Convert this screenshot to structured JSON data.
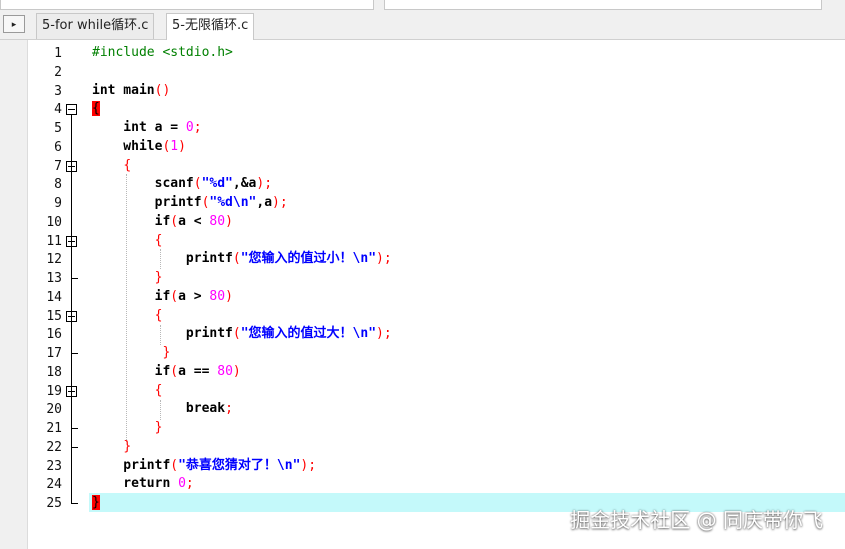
{
  "tabs": [
    {
      "label": "5-for while循环.c",
      "active": false
    },
    {
      "label": "5-无限循环.c",
      "active": true
    }
  ],
  "nav_button_glyph": "▸",
  "line_numbers": [
    "1",
    "2",
    "3",
    "4",
    "5",
    "6",
    "7",
    "8",
    "9",
    "10",
    "11",
    "12",
    "13",
    "14",
    "15",
    "16",
    "17",
    "18",
    "19",
    "20",
    "21",
    "22",
    "23",
    "24",
    "25"
  ],
  "current_line": 25,
  "colors": {
    "keyword": "#000000",
    "preprocessor": "#008000",
    "brace": "#ff0000",
    "string": "#0000ff",
    "number": "#ff00ff",
    "current_line_bg": "#c4f9fa"
  },
  "code": [
    [
      {
        "t": "#include <stdio.h>",
        "c": "pp"
      }
    ],
    [],
    [
      {
        "t": "int main",
        "c": "k"
      },
      {
        "t": "()",
        "c": "p"
      }
    ],
    [
      {
        "t": "{",
        "c": "pb"
      }
    ],
    [
      {
        "t": "    int a = ",
        "c": "k"
      },
      {
        "t": "0",
        "c": "n"
      },
      {
        "t": ";",
        "c": "p"
      }
    ],
    [
      {
        "t": "    while",
        "c": "k"
      },
      {
        "t": "(",
        "c": "p"
      },
      {
        "t": "1",
        "c": "n"
      },
      {
        "t": ")",
        "c": "p"
      }
    ],
    [
      {
        "t": "    ",
        "c": ""
      },
      {
        "t": "{",
        "c": "p"
      }
    ],
    [
      {
        "t": "        scanf",
        "c": "k"
      },
      {
        "t": "(",
        "c": "p"
      },
      {
        "t": "\"%d\"",
        "c": "s"
      },
      {
        "t": ",&a",
        "c": "k"
      },
      {
        "t": ");",
        "c": "p"
      }
    ],
    [
      {
        "t": "        printf",
        "c": "k"
      },
      {
        "t": "(",
        "c": "p"
      },
      {
        "t": "\"%d\\n\"",
        "c": "s"
      },
      {
        "t": ",a",
        "c": "k"
      },
      {
        "t": ");",
        "c": "p"
      }
    ],
    [
      {
        "t": "        if",
        "c": "k"
      },
      {
        "t": "(",
        "c": "p"
      },
      {
        "t": "a < ",
        "c": "k"
      },
      {
        "t": "80",
        "c": "n"
      },
      {
        "t": ")",
        "c": "p"
      }
    ],
    [
      {
        "t": "        ",
        "c": ""
      },
      {
        "t": "{",
        "c": "p"
      }
    ],
    [
      {
        "t": "            printf",
        "c": "k"
      },
      {
        "t": "(",
        "c": "p"
      },
      {
        "t": "\"您输入的值过小！\\n\"",
        "c": "s"
      },
      {
        "t": ");",
        "c": "p"
      }
    ],
    [
      {
        "t": "        ",
        "c": ""
      },
      {
        "t": "}",
        "c": "p"
      }
    ],
    [
      {
        "t": "        if",
        "c": "k"
      },
      {
        "t": "(",
        "c": "p"
      },
      {
        "t": "a > ",
        "c": "k"
      },
      {
        "t": "80",
        "c": "n"
      },
      {
        "t": ")",
        "c": "p"
      }
    ],
    [
      {
        "t": "        ",
        "c": ""
      },
      {
        "t": "{",
        "c": "p"
      }
    ],
    [
      {
        "t": "            printf",
        "c": "k"
      },
      {
        "t": "(",
        "c": "p"
      },
      {
        "t": "\"您输入的值过大！\\n\"",
        "c": "s"
      },
      {
        "t": ");",
        "c": "p"
      }
    ],
    [
      {
        "t": "         ",
        "c": ""
      },
      {
        "t": "}",
        "c": "p"
      }
    ],
    [
      {
        "t": "        if",
        "c": "k"
      },
      {
        "t": "(",
        "c": "p"
      },
      {
        "t": "a == ",
        "c": "k"
      },
      {
        "t": "80",
        "c": "n"
      },
      {
        "t": ")",
        "c": "p"
      }
    ],
    [
      {
        "t": "        ",
        "c": ""
      },
      {
        "t": "{",
        "c": "p"
      }
    ],
    [
      {
        "t": "            break",
        "c": "k"
      },
      {
        "t": ";",
        "c": "p"
      }
    ],
    [
      {
        "t": "        ",
        "c": ""
      },
      {
        "t": "}",
        "c": "p"
      }
    ],
    [
      {
        "t": "    ",
        "c": ""
      },
      {
        "t": "}",
        "c": "p"
      }
    ],
    [
      {
        "t": "    printf",
        "c": "k"
      },
      {
        "t": "(",
        "c": "p"
      },
      {
        "t": "\"恭喜您猜对了！\\n\"",
        "c": "s"
      },
      {
        "t": ");",
        "c": "p"
      }
    ],
    [
      {
        "t": "    return ",
        "c": "k"
      },
      {
        "t": "0",
        "c": "n"
      },
      {
        "t": ";",
        "c": "p"
      }
    ],
    [
      {
        "t": "}",
        "c": "pb"
      }
    ]
  ],
  "watermark": "掘金技术社区 @ 同庆带你飞"
}
